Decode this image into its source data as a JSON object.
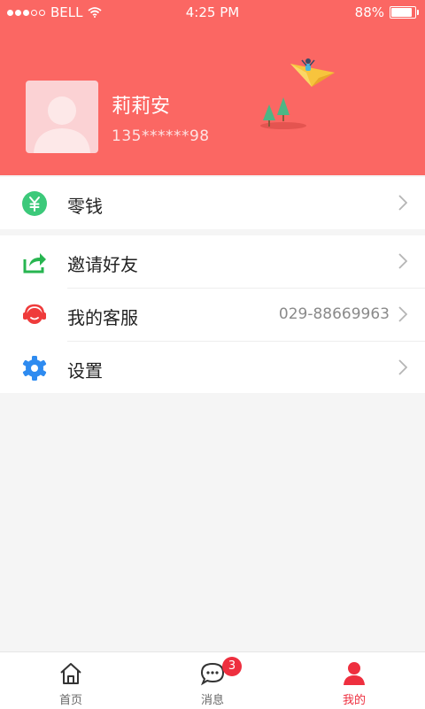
{
  "status_bar": {
    "carrier": "BELL",
    "time": "4:25 PM",
    "battery": "88%",
    "battery_level": 0.88,
    "signal_bars_filled": 3,
    "signal_bars_total": 5
  },
  "profile": {
    "name": "莉莉安",
    "phone": "135******98"
  },
  "menu": {
    "wallet": {
      "label": "零钱"
    },
    "invite": {
      "label": "邀请好友"
    },
    "support": {
      "label": "我的客服",
      "value": "029-88669963"
    },
    "settings": {
      "label": "设置"
    }
  },
  "tabs": [
    {
      "label": "首页",
      "icon": "home-icon",
      "active": false
    },
    {
      "label": "消息",
      "icon": "message-icon",
      "badge": "3",
      "active": false
    },
    {
      "label": "我的",
      "icon": "user-icon",
      "active": true
    }
  ],
  "colors": {
    "header": "#fb6763",
    "accent": "#ee2f3f",
    "wallet_icon": "#3cc97a",
    "invite_icon": "#27b550",
    "support_icon": "#ef3b3b",
    "settings_icon": "#2e8bf0"
  }
}
